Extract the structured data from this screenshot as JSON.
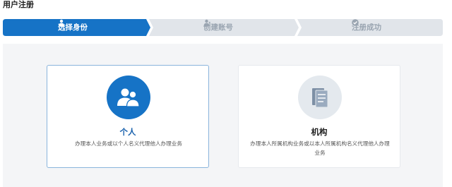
{
  "page": {
    "title": "用户注册"
  },
  "steps": [
    {
      "label": "选择身份",
      "icon": "user-icon",
      "state": "active"
    },
    {
      "label": "创建账号",
      "icon": "user-add-icon",
      "state": "pending"
    },
    {
      "label": "注册成功",
      "icon": "check-circle-icon",
      "state": "pending"
    }
  ],
  "colors": {
    "accent": "#1673c6",
    "inactive_step": "#e1e5ea",
    "inactive_text": "#9aa5b1"
  },
  "identity_options": [
    {
      "title": "个人",
      "description": "办理本人业务或以个人名义代理他人办理业务",
      "icon": "users-icon",
      "selected": true
    },
    {
      "title": "机构",
      "description": "办理本人所属机构业务或以本人所属机构名义代理他人办理业务",
      "icon": "document-icon",
      "selected": false
    }
  ]
}
